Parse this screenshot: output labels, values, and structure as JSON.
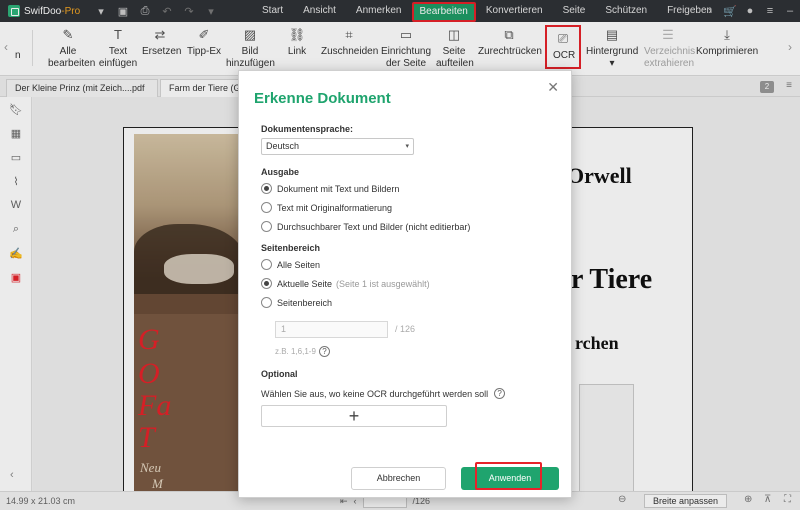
{
  "app": {
    "name": "SwifDoo",
    "edition": "-Pro"
  },
  "menu": [
    "Start",
    "Ansicht",
    "Anmerken",
    "Bearbeiten",
    "Konvertieren",
    "Seite",
    "Schützen",
    "Freigeben"
  ],
  "ribbon": {
    "partial_label": "n",
    "tools": [
      {
        "label": "Alle\nbearbeiten",
        "icon": "edit-all-icon"
      },
      {
        "label": "Text\neinfügen",
        "icon": "insert-text-icon"
      },
      {
        "label": "Ersetzen",
        "icon": "replace-icon"
      },
      {
        "label": "Tipp-Ex",
        "icon": "whiteout-icon"
      },
      {
        "label": "Bild\nhinzufügen",
        "icon": "add-image-icon"
      },
      {
        "label": "Link",
        "icon": "link-icon"
      },
      {
        "label": "Zuschneiden",
        "icon": "crop-icon"
      },
      {
        "label": "Einrichtung\nder Seite",
        "icon": "page-setup-icon"
      },
      {
        "label": "Seite\naufteilen",
        "icon": "split-page-icon"
      },
      {
        "label": "Zurechtrücken",
        "icon": "deskew-icon"
      },
      {
        "label": "OCR",
        "icon": "ocr-icon"
      },
      {
        "label": "Hintergrund",
        "icon": "background-icon"
      },
      {
        "label": "Verzeichnis\nextrahieren",
        "icon": "extract-toc-icon"
      },
      {
        "label": "Komprimieren",
        "icon": "compress-icon"
      }
    ]
  },
  "tabs": [
    {
      "label": "Der Kleine Prinz (mit Zeich....pdf"
    },
    {
      "label": "Farm der Tiere (Ge"
    }
  ],
  "tab_count": "2",
  "document": {
    "cover_title_lines": [
      "G",
      "O",
      "Fa",
      "T"
    ],
    "cover_subtitles": [
      "Neu",
      "M",
      "Mi"
    ],
    "author_fragment": "Orwell",
    "title_fragment": "r Tiere",
    "subtitle_fragment": "rchen"
  },
  "dialog": {
    "title": "Erkenne Dokument",
    "language_label": "Dokumentensprache:",
    "language_value": "Deutsch",
    "output_label": "Ausgabe",
    "output_options": [
      {
        "label": "Dokument mit Text und Bildern",
        "checked": true
      },
      {
        "label": "Text mit Originalformatierung",
        "checked": false
      },
      {
        "label": "Durchsuchbarer Text und Bilder (nicht editierbar)",
        "checked": false
      }
    ],
    "range_label": "Seitenbereich",
    "range_options": [
      {
        "label": "Alle Seiten",
        "checked": false,
        "hint": ""
      },
      {
        "label": "Aktuelle Seite",
        "checked": true,
        "hint": "(Seite 1 ist ausgewählt)"
      },
      {
        "label": "Seitenbereich",
        "checked": false,
        "hint": ""
      }
    ],
    "range_input_value": "1",
    "range_total": "/ 126",
    "range_example": "z.B. 1,6,1-9",
    "optional_label": "Optional",
    "optional_hint": "Wählen Sie aus, wo keine OCR durchgeführt werden soll",
    "add_symbol": "+",
    "cancel_label": "Abbrechen",
    "apply_label": "Anwenden"
  },
  "statusbar": {
    "page_size": "14.99 x 21.03 cm",
    "page_total": "/126",
    "fit_label": "Breite anpassen"
  },
  "colors": {
    "accent": "#1fa46e",
    "highlight": "#e8222a",
    "titlebar": "#2f3237"
  }
}
